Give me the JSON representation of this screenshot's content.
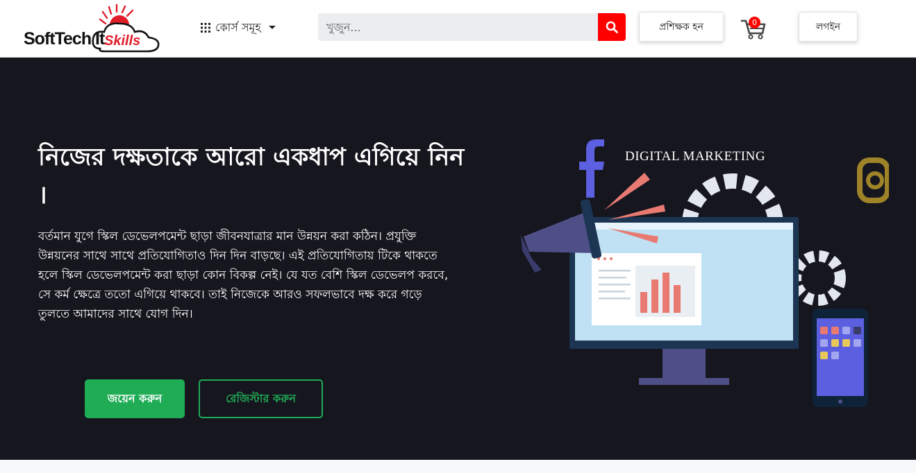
{
  "brand": {
    "name": "SoftTech It",
    "sub": "Skills",
    "accent": "#e11d2a"
  },
  "nav": {
    "courses_label": "কোর্স সমূহ",
    "courses_icon": "grid-icon",
    "chevron_icon": "chevron-down-icon"
  },
  "search": {
    "placeholder": "খুজুন...",
    "value": "",
    "button_icon": "search-icon",
    "button_color": "#ff0000"
  },
  "header_actions": {
    "instructor_label": "প্রশিক্ষক হন",
    "cart_icon": "cart-icon",
    "cart_count": "0",
    "login_label": "লগইন"
  },
  "hero": {
    "title": "নিজের দক্ষতাকে আরো একধাপ এগিয়ে নিন ।",
    "description": "বর্তমান যুগে স্কিল ডেভেলপমেন্ট ছাড়া জীবনযাত্রার মান উন্নয়ন করা কঠিন। প্রযুক্তি উন্নয়নের সাথে সাথে প্রতিযোগিতাও দিন দিন বাড়ছে। এই প্রতিযোগিতায় টিকে থাকতে হলে স্কিল ডেভেলপমেন্ট করা ছাড়া কোন বিকল্প নেই। যে যত বেশি স্কিল ডেভেলপ করবে, সে কর্ম ক্ষেত্রে ততো এগিয়ে থাকবে। তাই নিজেকে আরও সফলভাবে দক্ষ করে গড়ে তুলতে আমাদের সাথে যোগ দিন।",
    "join_label": "জয়েন করুন",
    "register_label": "রেজিস্টার করুন",
    "background": "#16161f",
    "green": "#1fac55"
  },
  "illustration": {
    "label": "DIGITAL MARKETING",
    "icons": [
      "facebook-icon",
      "megaphone-icon",
      "gear-icon",
      "monitor-icon",
      "phone-icon",
      "instagram-icon"
    ]
  }
}
